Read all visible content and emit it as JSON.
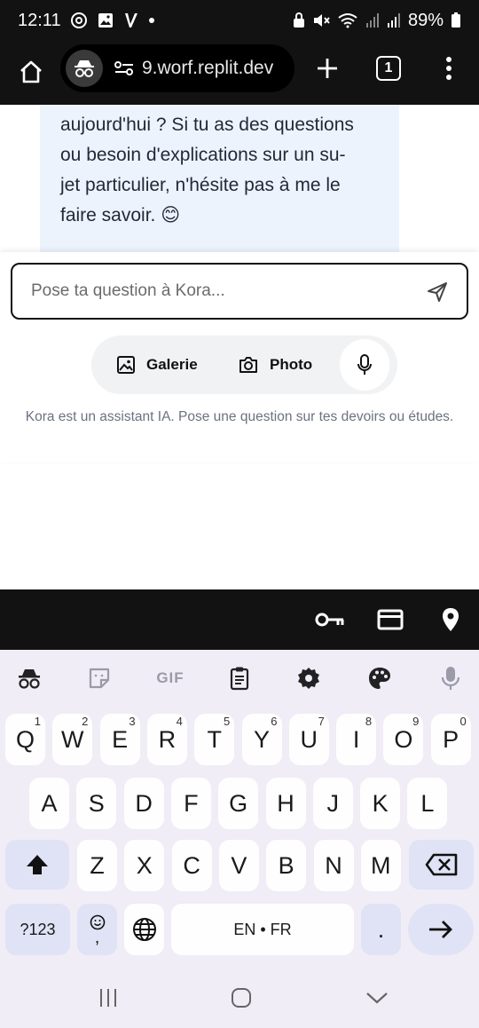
{
  "status_bar": {
    "time": "12:11",
    "battery": "89%",
    "left_icons": [
      "threads-icon",
      "gallery-icon",
      "v-app-icon"
    ],
    "right_icons": [
      "lock-icon",
      "mute-icon",
      "wifi-icon",
      "signal-icon",
      "signal-icon",
      "battery-icon"
    ]
  },
  "browser": {
    "url": "9.worf.replit.dev",
    "tab_count": "1"
  },
  "chat": {
    "message_lines": [
      "aujourd'hui ? Si tu as des questions",
      "ou besoin d'explications sur un su-",
      "jet particulier, n'hésite pas à me le",
      "faire savoir. 😊"
    ]
  },
  "composer": {
    "placeholder": "Pose ta question à Kora...",
    "gallery_label": "Galerie",
    "photo_label": "Photo",
    "disclaimer": "Kora est un assistant IA. Pose une question sur tes devoirs ou études."
  },
  "keyboard": {
    "row1": [
      {
        "k": "Q",
        "n": "1"
      },
      {
        "k": "W",
        "n": "2"
      },
      {
        "k": "E",
        "n": "3"
      },
      {
        "k": "R",
        "n": "4"
      },
      {
        "k": "T",
        "n": "5"
      },
      {
        "k": "Y",
        "n": "6"
      },
      {
        "k": "U",
        "n": "7"
      },
      {
        "k": "I",
        "n": "8"
      },
      {
        "k": "O",
        "n": "9"
      },
      {
        "k": "P",
        "n": "0"
      }
    ],
    "row2": [
      "A",
      "S",
      "D",
      "F",
      "G",
      "H",
      "J",
      "K",
      "L"
    ],
    "row3": [
      "Z",
      "X",
      "C",
      "V",
      "B",
      "N",
      "M"
    ],
    "symbols_label": "?123",
    "comma_label": ",",
    "space_label": "EN • FR",
    "period_label": ".",
    "gif_label": "GIF"
  },
  "colors": {
    "bubble_bg": "#edf3fd",
    "func_key": "#dfe3f5",
    "keyboard_bg": "#f0edf6"
  }
}
